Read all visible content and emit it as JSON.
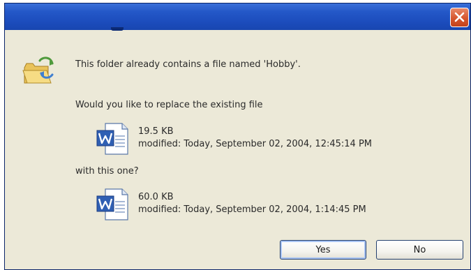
{
  "dialog": {
    "message": "This folder already contains a file named 'Hobby'.",
    "question": "Would you like to replace the existing file",
    "with_text": "with this one?",
    "existing_file": {
      "size": "19.5 KB",
      "modified": "modified: Today, September 02, 2004, 12:45:14 PM",
      "icon": "word-document-icon"
    },
    "new_file": {
      "size": "60.0 KB",
      "modified": "modified: Today, September 02, 2004, 1:14:45 PM",
      "icon": "word-document-icon"
    },
    "buttons": {
      "yes": "Yes",
      "no": "No"
    }
  },
  "icons": {
    "close": "close-icon",
    "folder": "folder-replace-icon"
  },
  "colors": {
    "titlebar": "#2458c8",
    "close_button": "#d6562e",
    "dialog_bg": "#ece9d8"
  }
}
